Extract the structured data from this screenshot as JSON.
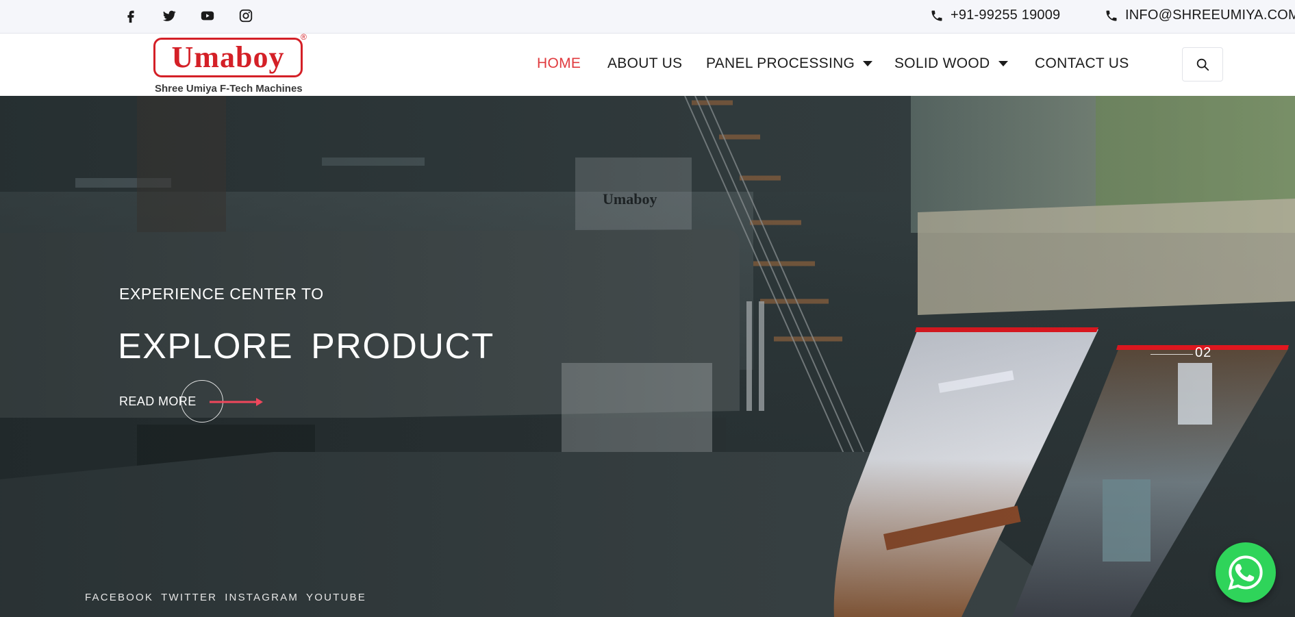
{
  "topbar": {
    "social": [
      {
        "icon": "facebook-icon"
      },
      {
        "icon": "twitter-icon"
      },
      {
        "icon": "youtube-icon"
      },
      {
        "icon": "instagram-icon"
      }
    ],
    "phone": "+91-99255 19009",
    "email": "INFO@SHREEUMIYA.COM"
  },
  "logo": {
    "wordmark": "Umaboy",
    "registered": "®",
    "tagline": "Shree Umiya F-Tech Machines"
  },
  "nav": {
    "items": [
      {
        "label": "HOME",
        "active": true,
        "dropdown": false
      },
      {
        "label": "ABOUT US",
        "active": false,
        "dropdown": false
      },
      {
        "label": "PANEL PROCESSING",
        "active": false,
        "dropdown": true
      },
      {
        "label": "SOLID WOOD",
        "active": false,
        "dropdown": true
      },
      {
        "label": "CONTACT US",
        "active": false,
        "dropdown": false
      }
    ],
    "search_icon": "search-icon"
  },
  "hero": {
    "eyebrow": "EXPERIENCE CENTER TO",
    "headline": "EXPLORE PRODUCT",
    "cta_label": "READ MORE",
    "slide_number": "02",
    "footer_links": [
      "FACEBOOK",
      "TWITTER",
      "INSTAGRAM",
      "YOUTUBE"
    ]
  },
  "colors": {
    "accent": "#e03a3e",
    "brand_red": "#d42027",
    "arrow": "#f0475c",
    "whatsapp": "#2fd45a"
  }
}
